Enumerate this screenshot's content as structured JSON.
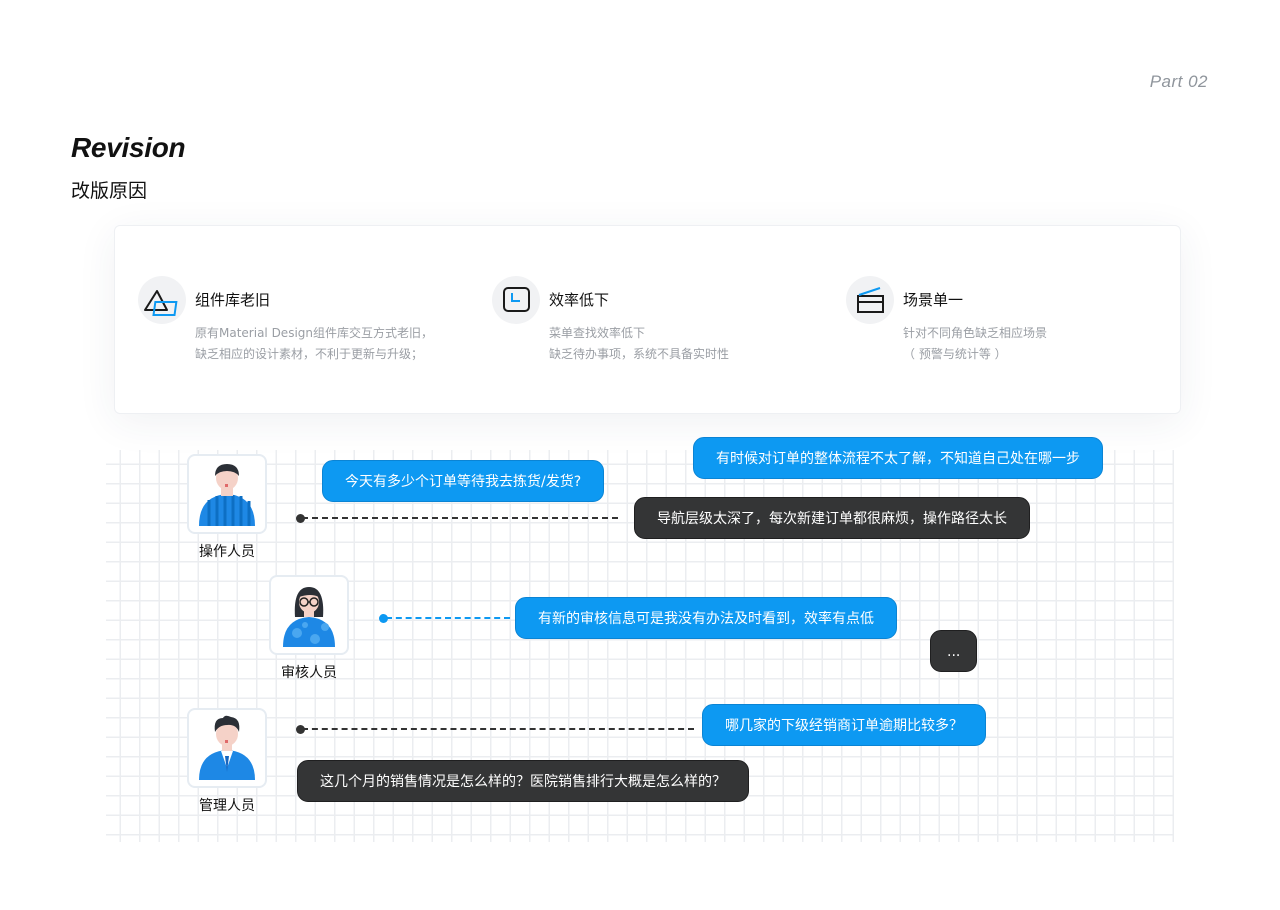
{
  "header": {
    "part": "Part  02",
    "title_en": "Revision",
    "title_cn": "改版原因"
  },
  "issues": [
    {
      "icon": "outdated-components-icon",
      "title": "组件库老旧",
      "line1": "原有Material Design组件库交互方式老旧，",
      "line2": "缺乏相应的设计素材，不利于更新与升级；"
    },
    {
      "icon": "clock-icon",
      "title": "效率低下",
      "line1": "菜单查找效率低下",
      "line2": "缺乏待办事项，系统不具备实时性"
    },
    {
      "icon": "scene-clapper-icon",
      "title": "场景单一",
      "line1": "针对不同角色缺乏相应场景",
      "line2": "（ 预警与统计等 ）"
    }
  ],
  "roles": {
    "operator": "操作人员",
    "reviewer": "审核人员",
    "manager": "管理人员"
  },
  "messages": {
    "op_1": "今天有多少个订单等待我去拣货/发货?",
    "op_2": "有时候对订单的整体流程不太了解，不知道自己处在哪一步",
    "op_3": "导航层级太深了，每次新建订单都很麻烦，操作路径太长",
    "rv_1": "有新的审核信息可是我没有办法及时看到，效率有点低",
    "rv_2": "...",
    "mg_1": "哪几家的下级经销商订单逾期比较多？",
    "mg_2": "这几个月的销售情况是怎么样的？医院销售排行大概是怎么样的？"
  },
  "colors": {
    "accent_blue": "#0d99f2",
    "dark_bubble": "#343536",
    "muted_text": "#9a9ea4"
  }
}
